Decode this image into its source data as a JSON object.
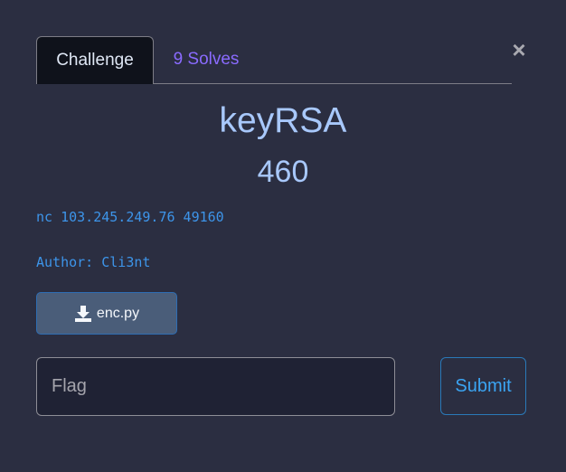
{
  "modal": {
    "close_glyph": "×",
    "tabs": [
      {
        "label": "Challenge",
        "active": true
      },
      {
        "label": "9 Solves",
        "active": false
      }
    ],
    "challenge": {
      "name": "keyRSA",
      "value": "460",
      "connection": "nc 103.245.249.76 49160",
      "author": "Author: Cli3nt"
    },
    "files": [
      {
        "name": "enc.py",
        "icon": "download-icon"
      }
    ],
    "flag_input": {
      "placeholder": "Flag",
      "value": ""
    },
    "submit_label": "Submit"
  },
  "colors": {
    "background": "#2b2e41",
    "title": "#a8c8fb",
    "link": "#3d95ea",
    "solves_tab": "#8a6bff",
    "file_button": "#4a5d79",
    "submit_text": "#3ba4f2"
  }
}
